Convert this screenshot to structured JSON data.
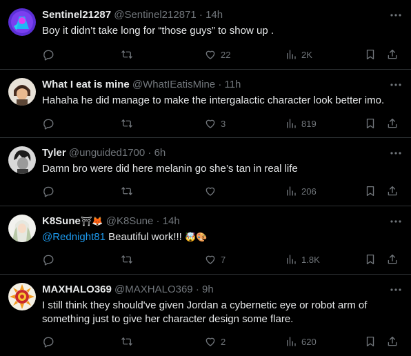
{
  "tweets": [
    {
      "display_name": "Sentinel21287",
      "handle": "@Sentinel212871",
      "dot": "·",
      "time": "14h",
      "text": "Boy it didn’t take long for “those guys” to show up .",
      "reply_count": "",
      "repost_count": "",
      "like_count": "22",
      "view_count": "2K",
      "avatar": "purple-robot-avatar"
    },
    {
      "display_name": "What I eat is mine",
      "handle": "@WhatIEatisMine",
      "dot": "·",
      "time": "11h",
      "text": "Hahaha he did manage to make the intergalactic character look better imo.",
      "reply_count": "",
      "repost_count": "",
      "like_count": "3",
      "view_count": "819",
      "avatar": "anime-character-avatar"
    },
    {
      "display_name": "Tyler",
      "handle": "@unguided1700",
      "dot": "·",
      "time": "6h",
      "text": "Damn bro were did here melanin go she’s tan in real life",
      "reply_count": "",
      "repost_count": "",
      "like_count": "",
      "view_count": "206",
      "avatar": "grayscale-character-avatar"
    },
    {
      "display_name": "K8Sune",
      "name_emojis": "⛩🦊",
      "handle": "@K8Sune",
      "dot": "·",
      "time": "14h",
      "mention": "@Rednight81",
      "text": "Beautiful work!!!",
      "text_emojis": "🤯🎨",
      "reply_count": "",
      "repost_count": "",
      "like_count": "7",
      "view_count": "1.8K",
      "avatar": "white-haired-character-avatar"
    },
    {
      "display_name": "MAXHALO369",
      "handle": "@MAXHALO369",
      "dot": "·",
      "time": "9h",
      "text_line1": "I still think they should've given Jordan a cybernetic eye or robot arm of",
      "text_line2": "something just to give her character design some flare.",
      "reply_count": "",
      "repost_count": "",
      "like_count": "2",
      "view_count": "620",
      "avatar": "sun-emblem-avatar"
    }
  ],
  "colors": {
    "background": "#000000",
    "primary_text": "#e7e9ea",
    "secondary_text": "#71767b",
    "link": "#1d9bf0",
    "divider": "#2f3336"
  },
  "icons": [
    "more-icon",
    "reply-icon",
    "repost-icon",
    "like-icon",
    "views-icon",
    "bookmark-icon",
    "share-icon"
  ]
}
